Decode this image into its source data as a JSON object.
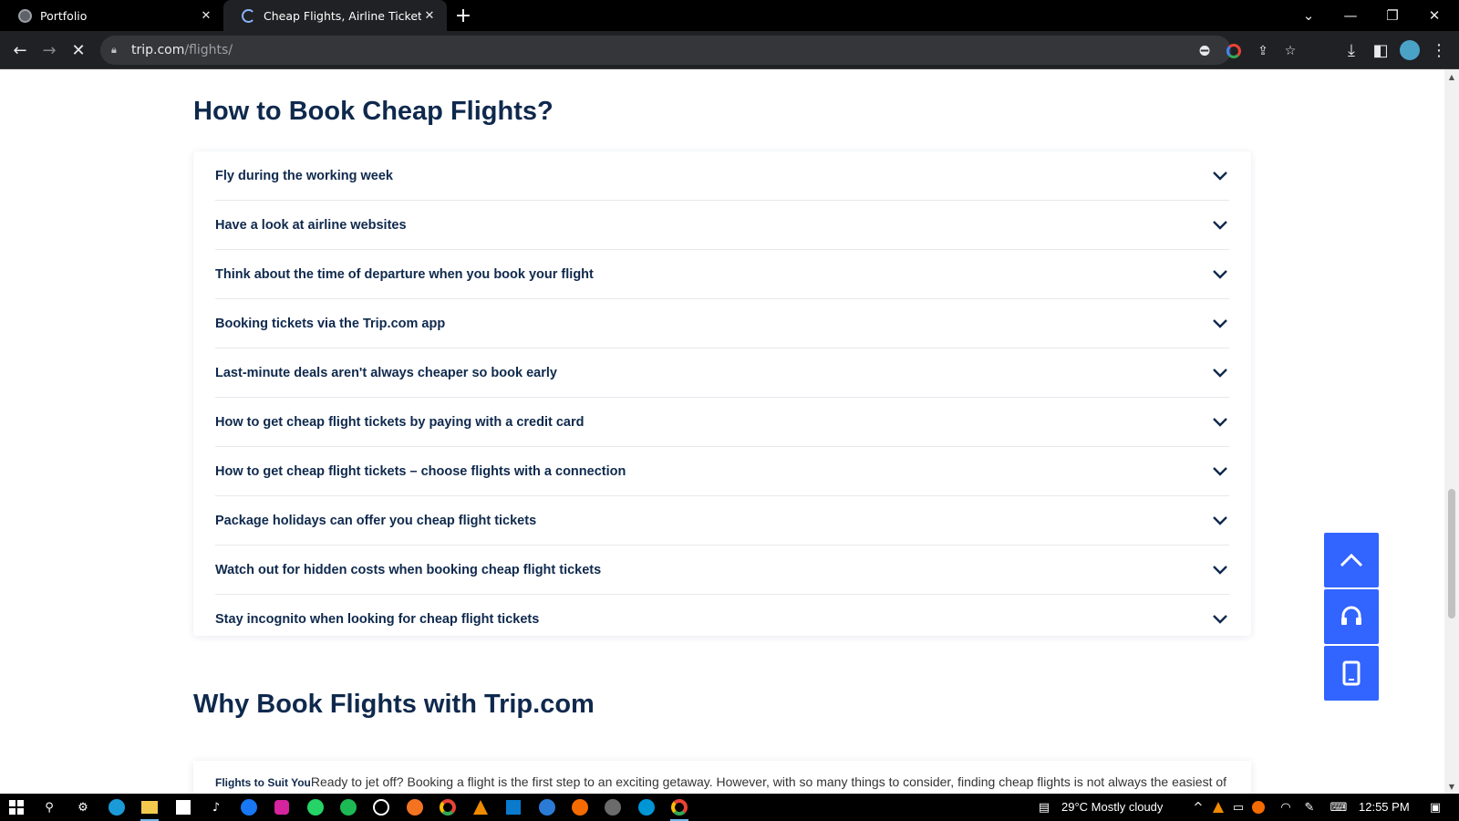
{
  "browser": {
    "tabs": [
      {
        "title": "Portfolio",
        "active": false
      },
      {
        "title": "Cheap Flights, Airline Tickets & P",
        "active": true
      }
    ],
    "url_host": "trip.com",
    "url_path": "/flights/"
  },
  "page": {
    "faq_heading": "How to Book Cheap Flights?",
    "faq_items": [
      "Fly during the working week",
      "Have a look at airline websites",
      "Think about the time of departure when you book your flight",
      "Booking tickets via the Trip.com app",
      "Last-minute deals aren't always cheaper so book early",
      "How to get cheap flight tickets by paying with a credit card",
      "How to get cheap flight tickets – choose flights with a connection",
      "Package holidays can offer you cheap flight tickets",
      "Watch out for hidden costs when booking cheap flight tickets",
      "Stay incognito when looking for cheap flight tickets"
    ],
    "why_heading": "Why Book Flights with Trip.com",
    "why_label": "Flights to Suit You",
    "why_text": "Ready to jet off? Booking a flight is the first step to an exciting getaway. However, with so many things to consider, finding cheap flights is not always the easiest of"
  },
  "colors": {
    "heading": "#0f294d",
    "float_button": "#3264ff"
  },
  "taskbar": {
    "weather": "29°C  Mostly cloudy",
    "time": "12:55 PM"
  }
}
